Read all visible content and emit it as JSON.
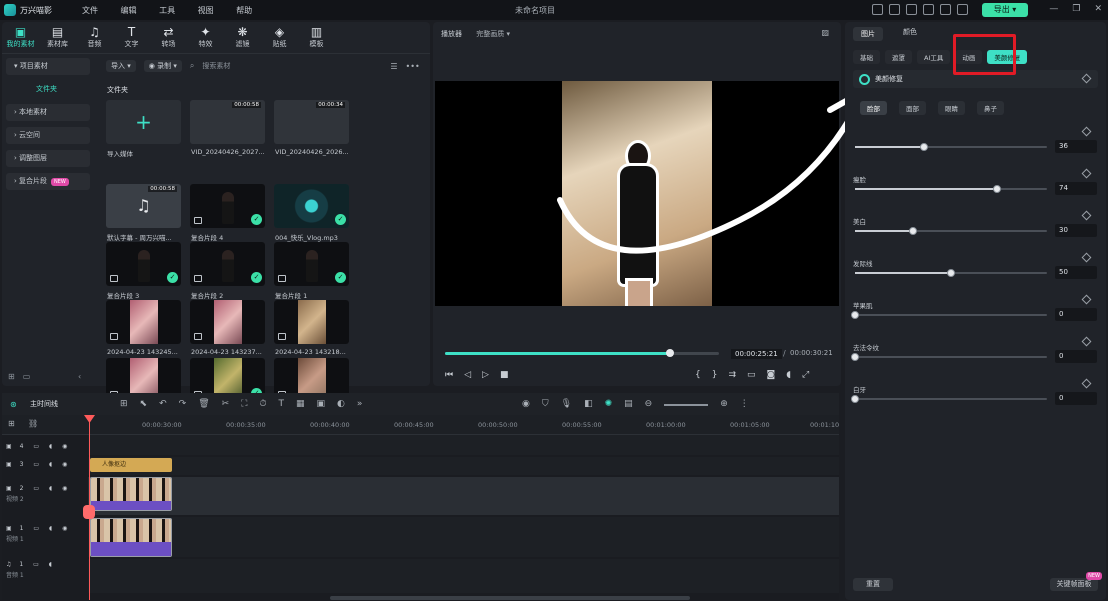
{
  "titlebar": {
    "app": "万兴喵影",
    "menus": [
      "文件",
      "编辑",
      "工具",
      "视图",
      "帮助"
    ],
    "project": "未命名项目",
    "export_label": "导出"
  },
  "media_tabs": [
    {
      "label": "我的素材",
      "icon": "folder-icon"
    },
    {
      "label": "素材库",
      "icon": "library-icon"
    },
    {
      "label": "音频",
      "icon": "music-icon"
    },
    {
      "label": "文字",
      "icon": "text-icon"
    },
    {
      "label": "转场",
      "icon": "transition-icon"
    },
    {
      "label": "特效",
      "icon": "effects-icon"
    },
    {
      "label": "滤镜",
      "icon": "filter-icon"
    },
    {
      "label": "贴纸",
      "icon": "sticker-icon"
    },
    {
      "label": "模板",
      "icon": "template-icon"
    }
  ],
  "nav": {
    "project": "项目素材",
    "folder": "文件夹",
    "local": "本地素材",
    "cloud": "云空间",
    "adjust": "调整图层",
    "compound": "复合片段",
    "new_badge": "NEW"
  },
  "toolbar": {
    "import": "导入",
    "record": "录制",
    "search_placeholder": "搜索素材"
  },
  "folder_title": "文件夹",
  "media": [
    {
      "caption": "导入媒体"
    },
    {
      "caption": "VID_20240426_2027...",
      "duration": "00:00:58"
    },
    {
      "caption": "VID_20240426_2026...",
      "duration": "00:00:34"
    },
    {
      "caption": "默认字幕 - 周万兴喵...",
      "duration": "00:00:58"
    },
    {
      "caption": "复合片段 4"
    },
    {
      "caption": "004_快乐_Vlog.mp3"
    },
    {
      "caption": "复合片段 3"
    },
    {
      "caption": "复合片段 2"
    },
    {
      "caption": "复合片段 1"
    },
    {
      "caption": "2024-04-23 143245..."
    },
    {
      "caption": "2024-04-23 143237..."
    },
    {
      "caption": "2024-04-23 143218..."
    },
    {
      "caption": ""
    },
    {
      "caption": ""
    },
    {
      "caption": ""
    }
  ],
  "preview": {
    "label": "播放器",
    "quality": "完整画质",
    "current": "00:00:25:21",
    "sep": "/",
    "total": "00:00:30:21",
    "progress": 0.82
  },
  "props": {
    "tabs": [
      "图片",
      "颜色"
    ],
    "subtabs": [
      "基础",
      "遮罩",
      "AI工具",
      "动画",
      "美颜修复"
    ],
    "section": "美颜修复",
    "parts": [
      "脸部",
      "面部",
      "眼睛",
      "鼻子"
    ],
    "sliders": [
      {
        "label": "",
        "value": "36",
        "frac": 0.36
      },
      {
        "label": "瘦脸",
        "value": "74",
        "frac": 0.74
      },
      {
        "label": "美白",
        "value": "30",
        "frac": 0.3
      },
      {
        "label": "发际线",
        "value": "50",
        "frac": 0.5
      },
      {
        "label": "苹果肌",
        "value": "0",
        "frac": 0
      },
      {
        "label": "去法令纹",
        "value": "0",
        "frac": 0
      },
      {
        "label": "白牙",
        "value": "0",
        "frac": 0
      }
    ],
    "reset": "重置",
    "keyframe": "关键帧面板",
    "new_badge": "NEW"
  },
  "timeline": {
    "main": "主时间线",
    "ticks": [
      "00:00:30:00",
      "00:00:35:00",
      "00:00:40:00",
      "00:00:45:00",
      "00:00:50:00",
      "00:00:55:00",
      "00:01:00:00",
      "00:01:05:00",
      "00:01:10"
    ],
    "tracks": [
      {
        "label": "4"
      },
      {
        "label": "3"
      },
      {
        "label": "2",
        "name": "视频 2"
      },
      {
        "label": "1",
        "name": "视频 1"
      },
      {
        "label": "1",
        "name": "音频 1"
      }
    ],
    "title_clip": "人像抠边"
  },
  "colors": {
    "accent": "#3ee0c6",
    "export": "#3be0a7",
    "highlight": "#e11b26"
  }
}
